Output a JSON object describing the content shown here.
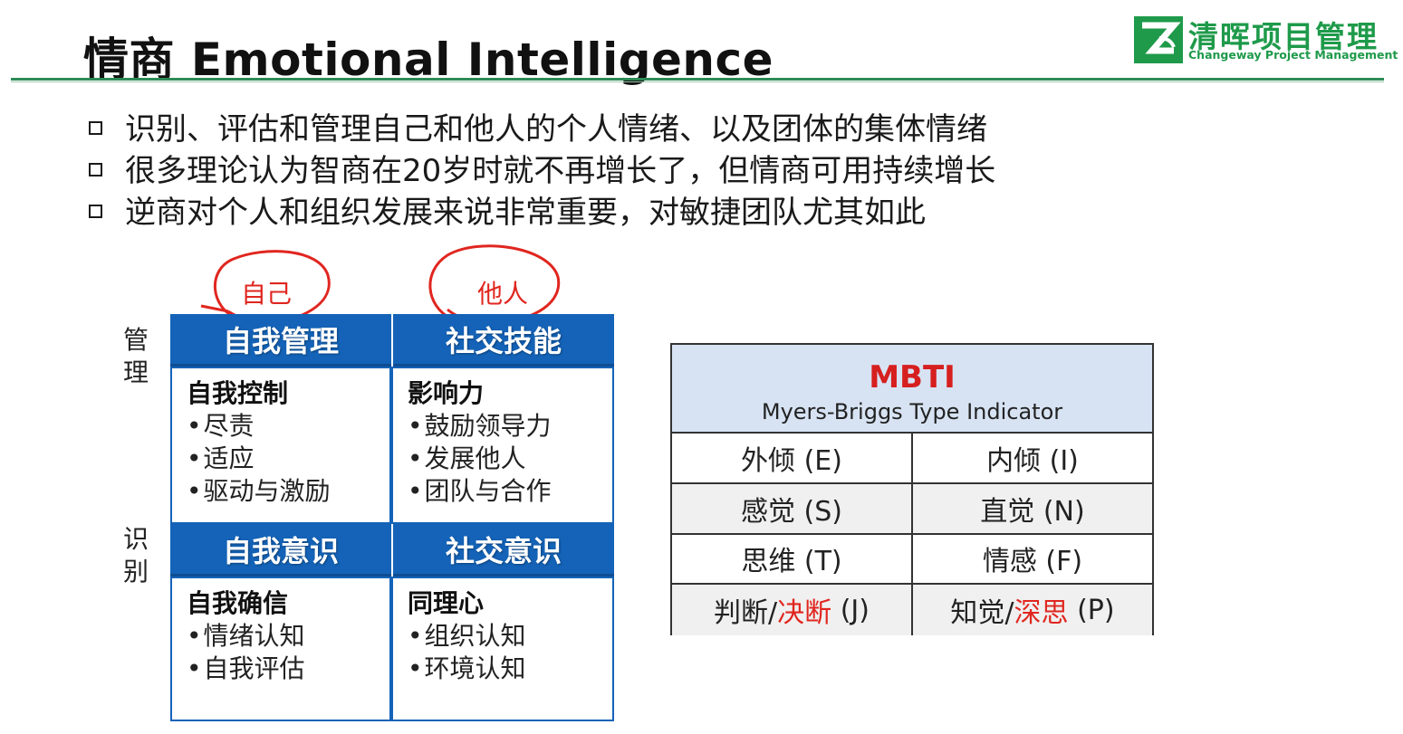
{
  "header": {
    "title": "情商 Emotional Intelligence",
    "logo_cn": "清晖项目管理",
    "logo_en": "Changeway Project Management",
    "accent_color": "#2e8b57",
    "logo_color": "#1e9a4a"
  },
  "bullets": [
    "识别、评估和管理自己和他人的个人情绪、以及团体的集体情绪",
    "很多理论认为智商在20岁时就不再增长了，但情商可用持续增长",
    "逆商对个人和组织发展来说非常重要，对敏捷团队尤其如此"
  ],
  "side_labels": {
    "manage": "管理",
    "recognize": "识别"
  },
  "annotations": {
    "self": "自己",
    "others": "他人",
    "color": "#e0261f"
  },
  "quadrants": {
    "header_color": "#1463b8",
    "top_left": {
      "header": "自我管理",
      "title": "自我控制",
      "items": [
        "尽责",
        "适应",
        "驱动与激励"
      ]
    },
    "top_right": {
      "header": "社交技能",
      "title": "影响力",
      "items": [
        "鼓励领导力",
        "发展他人",
        "团队与合作"
      ]
    },
    "bottom_left": {
      "header": "自我意识",
      "title": "自我确信",
      "items": [
        "情绪认知",
        "自我评估"
      ]
    },
    "bottom_right": {
      "header": "社交意识",
      "title": "同理心",
      "items": [
        "组织认知",
        "环境认知"
      ]
    }
  },
  "mbti": {
    "title": "MBTI",
    "subtitle": "Myers-Briggs Type Indicator",
    "header_bg": "#d7e3f3",
    "rows": [
      [
        "外倾 (E)",
        "内倾 (I)"
      ],
      [
        "感觉 (S)",
        "直觉 (N)"
      ],
      [
        "思维 (T)",
        "情感 (F)"
      ]
    ],
    "last_row": {
      "left": {
        "pre": "判断/",
        "red": "决断",
        "post": " (J)"
      },
      "right": {
        "pre": "知觉/",
        "red": "深思",
        "post": " (P)"
      }
    }
  }
}
